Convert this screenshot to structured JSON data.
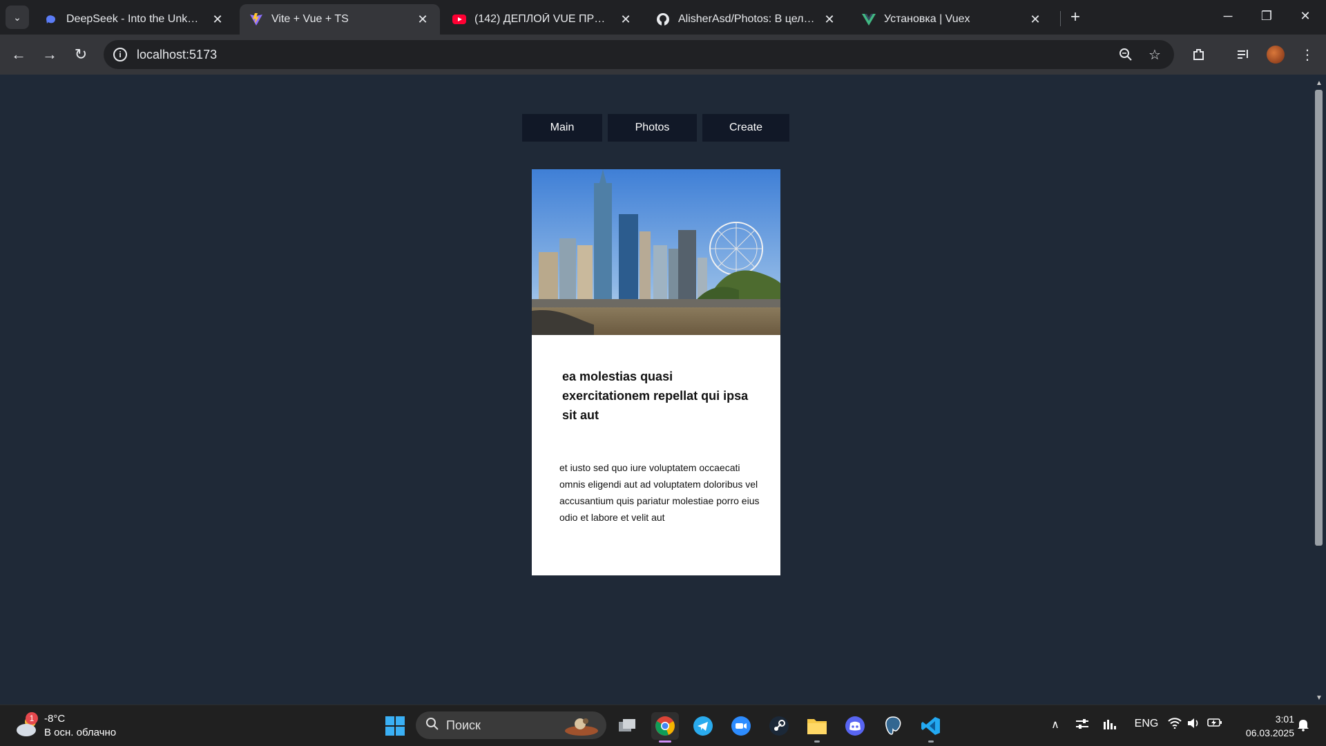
{
  "browser": {
    "tabs": [
      {
        "title": "DeepSeek - Into the Unknown",
        "icon": "deepseek-icon"
      },
      {
        "title": "Vite + Vue + TS",
        "icon": "vite-icon",
        "active": true
      },
      {
        "title": "(142) ДЕПЛОЙ VUE ПРИЛОЖЕНИЯ",
        "icon": "youtube-icon"
      },
      {
        "title": "AlisherAsd/Photos: В целях уче",
        "icon": "github-icon"
      },
      {
        "title": "Установка | Vuex",
        "icon": "vue-icon"
      }
    ],
    "address": "localhost:5173"
  },
  "page": {
    "nav": [
      {
        "label": "Main"
      },
      {
        "label": "Photos"
      },
      {
        "label": "Create"
      }
    ],
    "card": {
      "title": "ea molestias quasi exercitationem repellat qui ipsa sit aut",
      "body": "et iusto sed quo iure voluptatem occaecati omnis eligendi aut ad voluptatem doloribus vel accusantium quis pariatur molestiae porro eius odio et labore et velit aut"
    }
  },
  "taskbar": {
    "weather": {
      "badge": "1",
      "temp": "-8°C",
      "desc": "В осн. облачно"
    },
    "search_label": "Поиск",
    "language": "ENG",
    "time": "3:01",
    "date": "06.03.2025"
  },
  "colors": {
    "page_bg": "#1f2937",
    "nav_bg": "#111827",
    "card_bg": "#ffffff"
  }
}
